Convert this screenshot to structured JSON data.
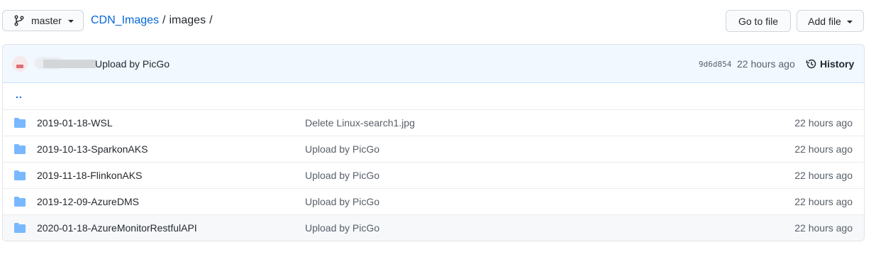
{
  "branch": {
    "label": "master"
  },
  "breadcrumb": {
    "repo": "CDN_Images",
    "sep1": "/",
    "folder": "images",
    "sep2": "/"
  },
  "actions": {
    "goto_label": "Go to file",
    "add_label": "Add file"
  },
  "commit": {
    "message": "Upload by PicGo",
    "sha": "9d6d854",
    "time": "22 hours ago",
    "history_label": "History"
  },
  "parent_dir": "..",
  "files": [
    {
      "name": "2019-01-18-WSL",
      "message": "Delete Linux-search1.jpg",
      "age": "22 hours ago"
    },
    {
      "name": "2019-10-13-SparkonAKS",
      "message": "Upload by PicGo",
      "age": "22 hours ago"
    },
    {
      "name": "2019-11-18-FlinkonAKS",
      "message": "Upload by PicGo",
      "age": "22 hours ago"
    },
    {
      "name": "2019-12-09-AzureDMS",
      "message": "Upload by PicGo",
      "age": "22 hours ago"
    },
    {
      "name": "2020-01-18-AzureMonitorRestfulAPI",
      "message": "Upload by PicGo",
      "age": "22 hours ago"
    }
  ],
  "colors": {
    "link": "#0366d6",
    "folder": "#79b8ff",
    "commit_bg": "#f1f8ff"
  }
}
